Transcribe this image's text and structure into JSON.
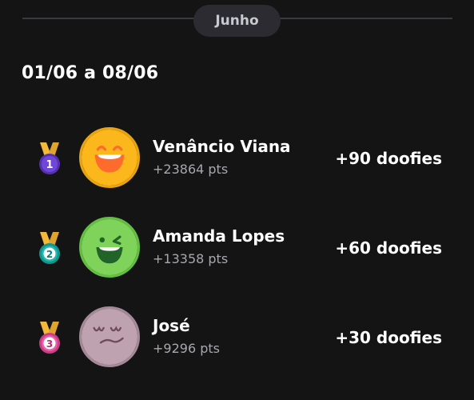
{
  "header": {
    "month": "Junho"
  },
  "week": {
    "range": "01/06 a 08/06"
  },
  "ranking": [
    {
      "rank": "1",
      "name": "Venâncio Viana",
      "points": "+23864 pts",
      "reward": "+90 doofies",
      "medal_color": "#7048d8",
      "avatar_color": "#fbb71c",
      "avatar_icon": "laughing-face-icon"
    },
    {
      "rank": "2",
      "name": "Amanda Lopes",
      "points": "+13358 pts",
      "reward": "+60 doofies",
      "medal_color": "#1fb8ad",
      "avatar_color": "#7fd35a",
      "avatar_icon": "winking-face-icon"
    },
    {
      "rank": "3",
      "name": "José",
      "points": "+9296 pts",
      "reward": "+30 doofies",
      "medal_color": "#ec5fa7",
      "avatar_color": "#bfa2b0",
      "avatar_icon": "sleepy-face-icon"
    }
  ]
}
